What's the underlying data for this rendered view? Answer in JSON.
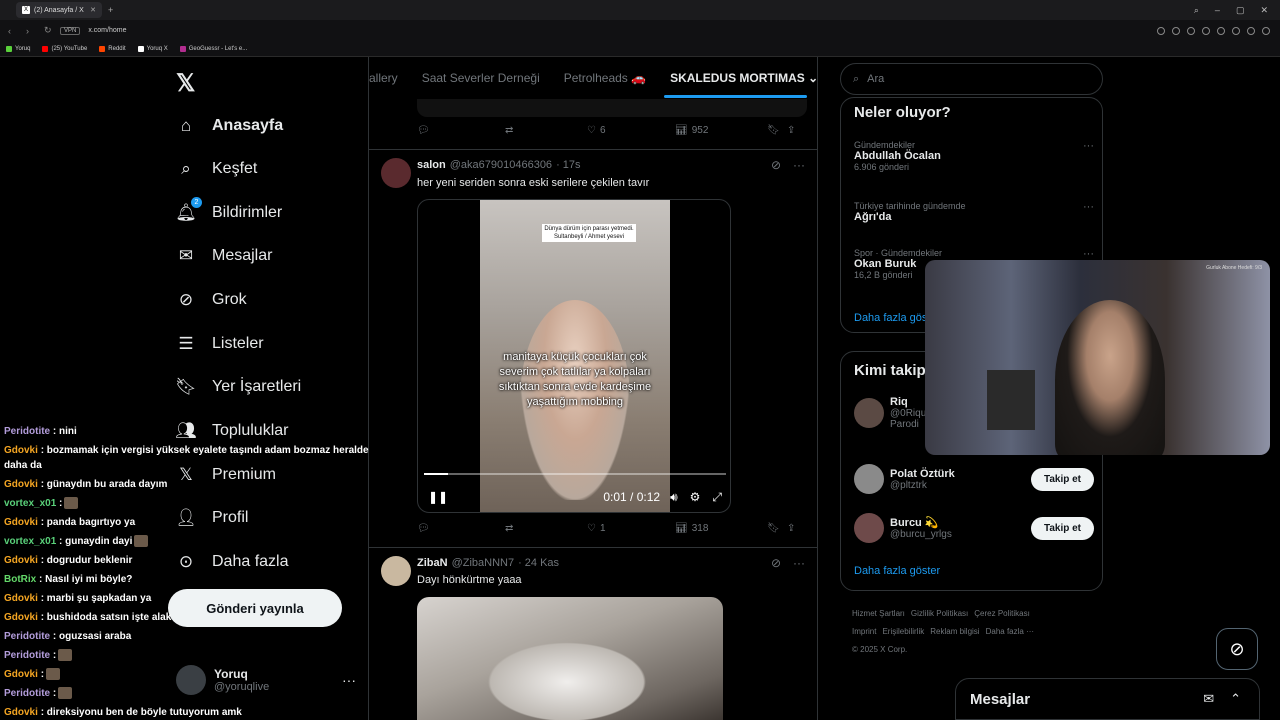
{
  "browser": {
    "tab_title": "(2) Anasayfa / X",
    "url": "x.com/home",
    "vpn_label": "VPN",
    "bookmarks": [
      {
        "label": "Yoruq",
        "color": "#5ad13b"
      },
      {
        "label": "(25) YouTube",
        "color": "#ff0000"
      },
      {
        "label": "Reddit",
        "color": "#ff4500"
      },
      {
        "label": "Yoruq X",
        "color": "#ffffff"
      },
      {
        "label": "GeoGuessr - Let's e...",
        "color": "#b22d8f"
      }
    ]
  },
  "nav": {
    "logo": "𝕏",
    "items": [
      {
        "label": "Anasayfa",
        "icon": "home-icon",
        "glyph": "⌂"
      },
      {
        "label": "Keşfet",
        "icon": "search-icon",
        "glyph": "⌕"
      },
      {
        "label": "Bildirimler",
        "icon": "bell-icon",
        "glyph": "🔔︎",
        "badge": "2"
      },
      {
        "label": "Mesajlar",
        "icon": "mail-icon",
        "glyph": "✉"
      },
      {
        "label": "Grok",
        "icon": "grok-icon",
        "glyph": "⊘"
      },
      {
        "label": "Listeler",
        "icon": "list-icon",
        "glyph": "☰"
      },
      {
        "label": "Yer İşaretleri",
        "icon": "bookmark-icon",
        "glyph": "🔖︎"
      },
      {
        "label": "Topluluklar",
        "icon": "communities-icon",
        "glyph": "👥︎"
      },
      {
        "label": "Premium",
        "icon": "x-premium-icon",
        "glyph": "𝕏"
      },
      {
        "label": "Profil",
        "icon": "profile-icon",
        "glyph": "👤︎"
      },
      {
        "label": "Daha fazla",
        "icon": "more-circle-icon",
        "glyph": "⊙"
      }
    ],
    "post_button": "Gönderi yayınla",
    "profile": {
      "name": "Yoruq",
      "handle": "@yoruqlive",
      "more": "···"
    }
  },
  "chat": [
    {
      "user": "Peridotite",
      "color": "#b39ddb",
      "msg": ": nini"
    },
    {
      "user": "Gdovki",
      "color": "#f5a623",
      "msg": ": bozmamak için vergisi yüksek eyalete taşındı adam bozmaz heralde daha da",
      "wrap": true
    },
    {
      "user": "Gdovki",
      "color": "#f5a623",
      "msg": ": günaydın bu arada dayım"
    },
    {
      "user": "vortex_x01",
      "color": "#5ad17a",
      "msg": ":",
      "emote": true
    },
    {
      "user": "Gdovki",
      "color": "#f5a623",
      "msg": ": panda bagırtıyo ya"
    },
    {
      "user": "vortex_x01",
      "color": "#5ad17a",
      "msg": ": gunaydin dayi",
      "emote": true
    },
    {
      "user": "Gdovki",
      "color": "#f5a623",
      "msg": ": dogrudur beklenir"
    },
    {
      "user": "BotRix",
      "color": "#64d96a",
      "msg": ": Nasıl iyi mi böyle?"
    },
    {
      "user": "Gdovki",
      "color": "#f5a623",
      "msg": ": marbi şu şapkadan ya"
    },
    {
      "user": "Gdovki",
      "color": "#f5a623",
      "msg": ": bushidoda satsın işte alak"
    },
    {
      "user": "Peridotite",
      "color": "#b39ddb",
      "msg": ": oguzsasi araba"
    },
    {
      "user": "Peridotite",
      "color": "#b39ddb",
      "msg": ":",
      "emote": true
    },
    {
      "user": "Gdovki",
      "color": "#f5a623",
      "msg": ":",
      "emote": true
    },
    {
      "user": "Peridotite",
      "color": "#b39ddb",
      "msg": ":",
      "emote": true
    },
    {
      "user": "Gdovki",
      "color": "#f5a623",
      "msg": ": direksiyonu ben de böyle tutuyorum amk"
    }
  ],
  "center": {
    "tabs": [
      "allery",
      "Saat Severler Derneği",
      "Petrolheads 🚗",
      "SKALEDUS MORTIMAS"
    ],
    "tab_caret": "⌄",
    "prev_actions": {
      "replies": "",
      "reposts": "",
      "likes": "6",
      "views": "952"
    },
    "tweet1": {
      "name": "salon",
      "handle": "@aka679010466306",
      "time": "· 17s",
      "text": "her yeni seriden sonra eski serilere çekilen tavır",
      "video": {
        "caption_top": "Dünya dürüm için parası yetmedi. Sultanbeyli / Ahmet yesevi",
        "caption_main": "manitaya küçük çocukları çok severim çok tatlılar ya kolpaları sıktıktan sonra evde kardeşime yaşattığım mobbing",
        "time": "0:01 / 0:12",
        "progress": 0.08
      },
      "actions": {
        "replies": "",
        "reposts": "",
        "likes": "1",
        "views": "318"
      }
    },
    "tweet2": {
      "name": "ZibaN",
      "handle": "@ZibaNNN7",
      "time": "· 24 Kas",
      "text": "Dayı hönkürtme yaaa"
    }
  },
  "right": {
    "search_placeholder": "Ara",
    "trends_title": "Neler oluyor?",
    "trends": [
      {
        "category": "Gündemdekiler",
        "name": "Abdullah Öcalan",
        "count": "6.906 gönderi"
      },
      {
        "category": "Türkiye tarihinde gündemde",
        "name": "Ağrı'da",
        "count": ""
      },
      {
        "category": "Spor · Gündemdekiler",
        "name": "Okan Buruk",
        "count": "16,2 B gönderi"
      }
    ],
    "trends_more": "Daha fazla göster",
    "who_title": "Kimi takip etmeli",
    "who": [
      {
        "name": "Riq",
        "handle": "@0Riqu",
        "extra": "Parodi",
        "follow": ""
      },
      {
        "name": "Polat Öztürk",
        "handle": "@pltztrk",
        "follow": "Takip et"
      },
      {
        "name": "Burcu 💫",
        "handle": "@burcu_yrlgs",
        "follow": "Takip et"
      }
    ],
    "who_more": "Daha fazla göster",
    "footer": [
      "Hizmet Şartları",
      "Gizlilik Politikası",
      "Çerez Politikası",
      "Imprint",
      "Erişilebilirlik",
      "Reklam bilgisi",
      "Daha fazla ···",
      "© 2025 X Corp."
    ]
  },
  "webcam": {
    "label": "Gurluk Abone Hedefi: 9/3"
  },
  "messages": {
    "title": "Mesajlar"
  }
}
